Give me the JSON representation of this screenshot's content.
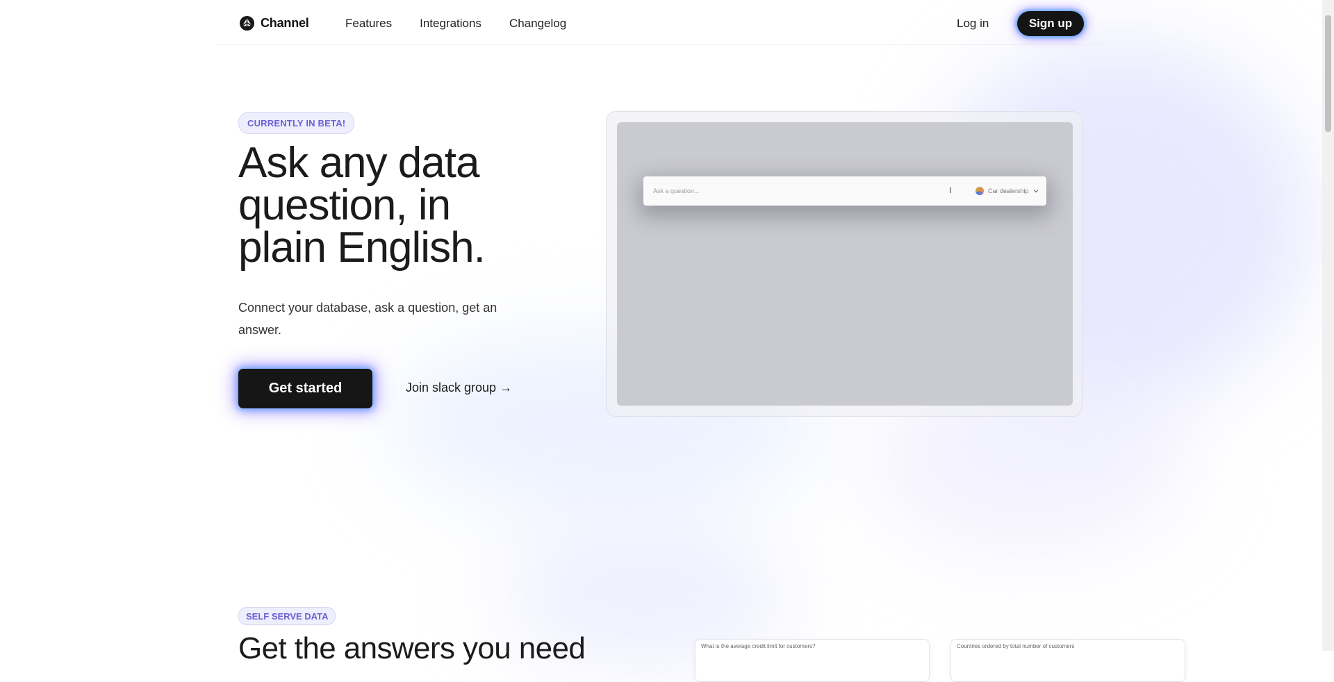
{
  "header": {
    "brand": "Channel",
    "nav": [
      "Features",
      "Integrations",
      "Changelog"
    ],
    "login": "Log in",
    "signup": "Sign up"
  },
  "hero": {
    "badge": "CURRENTLY IN BETA!",
    "title": "Ask any data question, in plain English.",
    "subtitle": "Connect your database, ask a question, get an answer.",
    "cta_primary": "Get started",
    "cta_secondary": "Join slack group →"
  },
  "demo": {
    "placeholder": "Ask a question...",
    "cursor_glyph": "I",
    "database": "Car dealership",
    "database_icon": "pie-chart-icon"
  },
  "section2": {
    "badge": "SELF SERVE DATA",
    "title": "Get the answers you need",
    "cards": [
      "What is the average credit limit for customers?",
      "Countries ordered by total number of customers"
    ]
  },
  "colors": {
    "badge_text": "#6b5fd3",
    "badge_bg": "#efeefd",
    "button_dark": "#161616",
    "glow_blue": "#40a0ff",
    "glow_purple": "#7c54ff",
    "demo_screen": "#cacad1"
  }
}
